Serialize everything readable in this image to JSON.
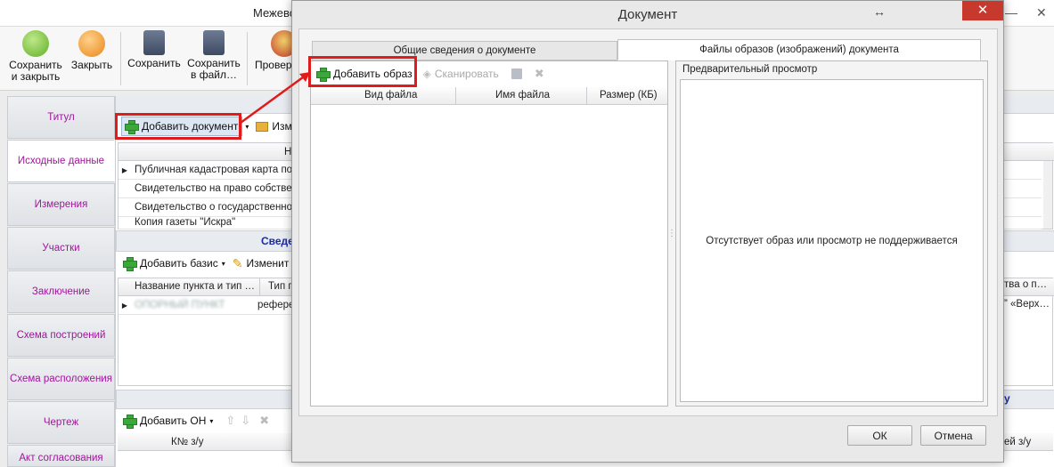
{
  "main_window": {
    "title": "Межево",
    "window_controls": {
      "restore": "↔",
      "minimize": "—",
      "maximize": "□",
      "close": "✕"
    }
  },
  "ribbon": {
    "save_close": "Сохранить и закрыть",
    "close": "Закрыть",
    "save": "Сохранить",
    "save_to_file": "Сохранить в файл…",
    "check": "Провер"
  },
  "left_tabs": [
    {
      "label": "Титул"
    },
    {
      "label": "Исходные данные"
    },
    {
      "label": "Измерения"
    },
    {
      "label": "Участки"
    },
    {
      "label": "Заключение"
    },
    {
      "label": "Схема построений"
    },
    {
      "label": "Схема расположения"
    },
    {
      "label": "Чертеж"
    },
    {
      "label": "Акт согласования"
    }
  ],
  "content": {
    "docs_toolbar": {
      "add_document": "Добавить документ",
      "edit": "Изме"
    },
    "docs_grid_header": "Н",
    "docs_rows": [
      "Публичная кадастровая карта по С",
      "Свидетельство на право собственн",
      "Свидетельство о государственной",
      "Копия газеты \"Искра\""
    ],
    "section2_title": "Сведе",
    "basis_toolbar": {
      "add_basis": "Добавить базис",
      "edit": "Изменит"
    },
    "basis_columns": {
      "name": "Название пункта и тип …",
      "type": "Тип п"
    },
    "basis_row": {
      "name": "ОПОРНЫЙ ПУНКТ",
      "type": "рефере"
    },
    "right_fragments": {
      "col": "тва о п…",
      "row": "” «Верх…",
      "col2": "ей з/у",
      "title_frag": "у"
    },
    "section3_toolbar": {
      "add_on": "Добавить ОН"
    },
    "on_columns": {
      "number": "К№ з/у"
    }
  },
  "dialog": {
    "title": "Документ",
    "controls": {
      "restore": "↔",
      "close": "✕"
    },
    "tabs": [
      {
        "label": "Общие сведения о документе",
        "active": false
      },
      {
        "label": "Файлы образов (изображений) документа",
        "active": true
      }
    ],
    "toolbar": {
      "add_image": "Добавить образ",
      "scan": "Сканировать"
    },
    "columns": {
      "file_type": "Вид файла",
      "file_name": "Имя файла",
      "size": "Размер (КБ)"
    },
    "preview": {
      "title": "Предварительный просмотр",
      "empty_message": "Отсутствует образ или просмотр не поддерживается"
    },
    "buttons": {
      "ok": "ОК",
      "cancel": "Отмена"
    }
  },
  "colors": {
    "highlight": "#e01b1b",
    "tab_text": "#a0159b",
    "section_title": "#1b2aa3",
    "close_button": "#c7392d"
  }
}
